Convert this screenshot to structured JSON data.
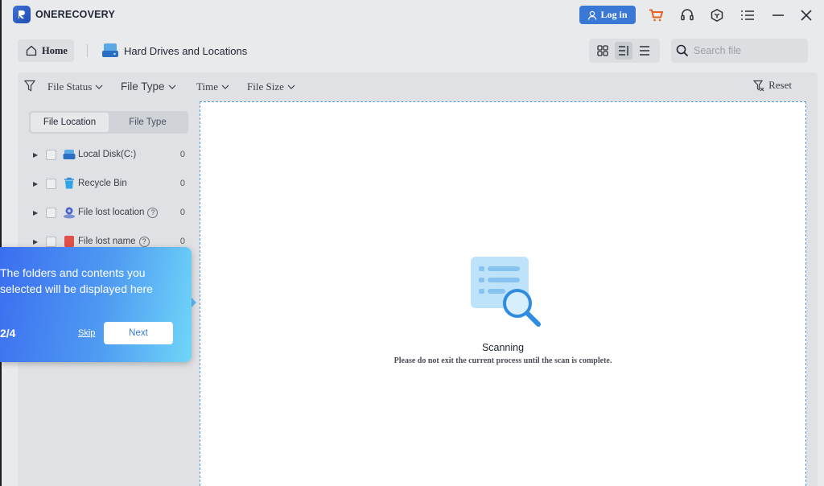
{
  "app": {
    "name": "ONERECOVERY",
    "login_label": "Log in"
  },
  "titlebar_icons": [
    "cart-icon",
    "headset-icon",
    "cube-icon",
    "menu-icon",
    "minimize-icon",
    "close-icon"
  ],
  "toolbar": {
    "home_label": "Home",
    "location_label": "Hard Drives and Locations",
    "search_placeholder": "Search file"
  },
  "filters": {
    "file_status": "File Status",
    "file_type": "File Type",
    "time": "Time",
    "file_size": "File Size",
    "reset": "Reset"
  },
  "tabs": {
    "location": "File Location",
    "type": "File Type"
  },
  "tree": [
    {
      "label": "Local Disk(C:)",
      "count": "0"
    },
    {
      "label": "Recycle Bin",
      "count": "0"
    },
    {
      "label": "File lost location",
      "count": "0"
    },
    {
      "label": "File lost name",
      "count": "0"
    }
  ],
  "scan": {
    "title": "Scanning",
    "subtitle": "Please do not exit the current process until the scan is complete."
  },
  "tooltip": {
    "text": "The folders and contents you\nselected will be displayed here",
    "step": "2/4",
    "skip": "Skip",
    "next": "Next"
  },
  "colors": {
    "accent": "#3a78d6",
    "dashed_border": "#4a9be8",
    "cart": "#e8621f"
  }
}
